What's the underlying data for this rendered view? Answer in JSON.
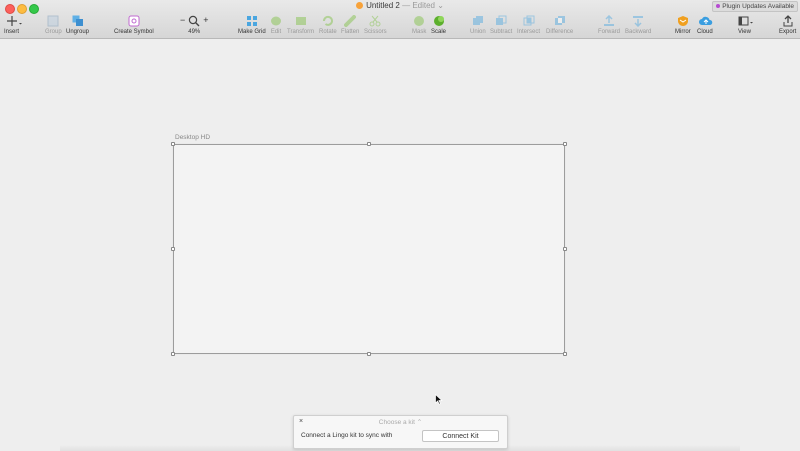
{
  "window": {
    "title": "Untitled 2",
    "status": "— Edited",
    "plugin_updates": "Plugin Updates Available"
  },
  "toolbar": {
    "insert": "Insert",
    "group": "Group",
    "ungroup": "Ungroup",
    "create_symbol": "Create Symbol",
    "zoom_minus": "−",
    "zoom_plus": "+",
    "zoom_level": "49%",
    "make_grid": "Make Grid",
    "edit": "Edit",
    "transform": "Transform",
    "rotate": "Rotate",
    "flatten": "Flatten",
    "scissors": "Scissors",
    "mask": "Mask",
    "scale": "Scale",
    "union": "Union",
    "subtract": "Subtract",
    "intersect": "Intersect",
    "difference": "Difference",
    "forward": "Forward",
    "backward": "Backward",
    "mirror": "Mirror",
    "cloud": "Cloud",
    "view": "View",
    "export": "Export"
  },
  "canvas": {
    "artboard_name": "Desktop HD"
  },
  "lingo": {
    "close": "×",
    "choose_kit": "Choose a kit ⌃",
    "message": "Connect a Lingo kit to sync with",
    "connect_button": "Connect Kit"
  },
  "colors": {
    "accent_green": "#7cc040",
    "accent_blue": "#4aa6e0",
    "plugin_dot": "#b64bd1"
  }
}
